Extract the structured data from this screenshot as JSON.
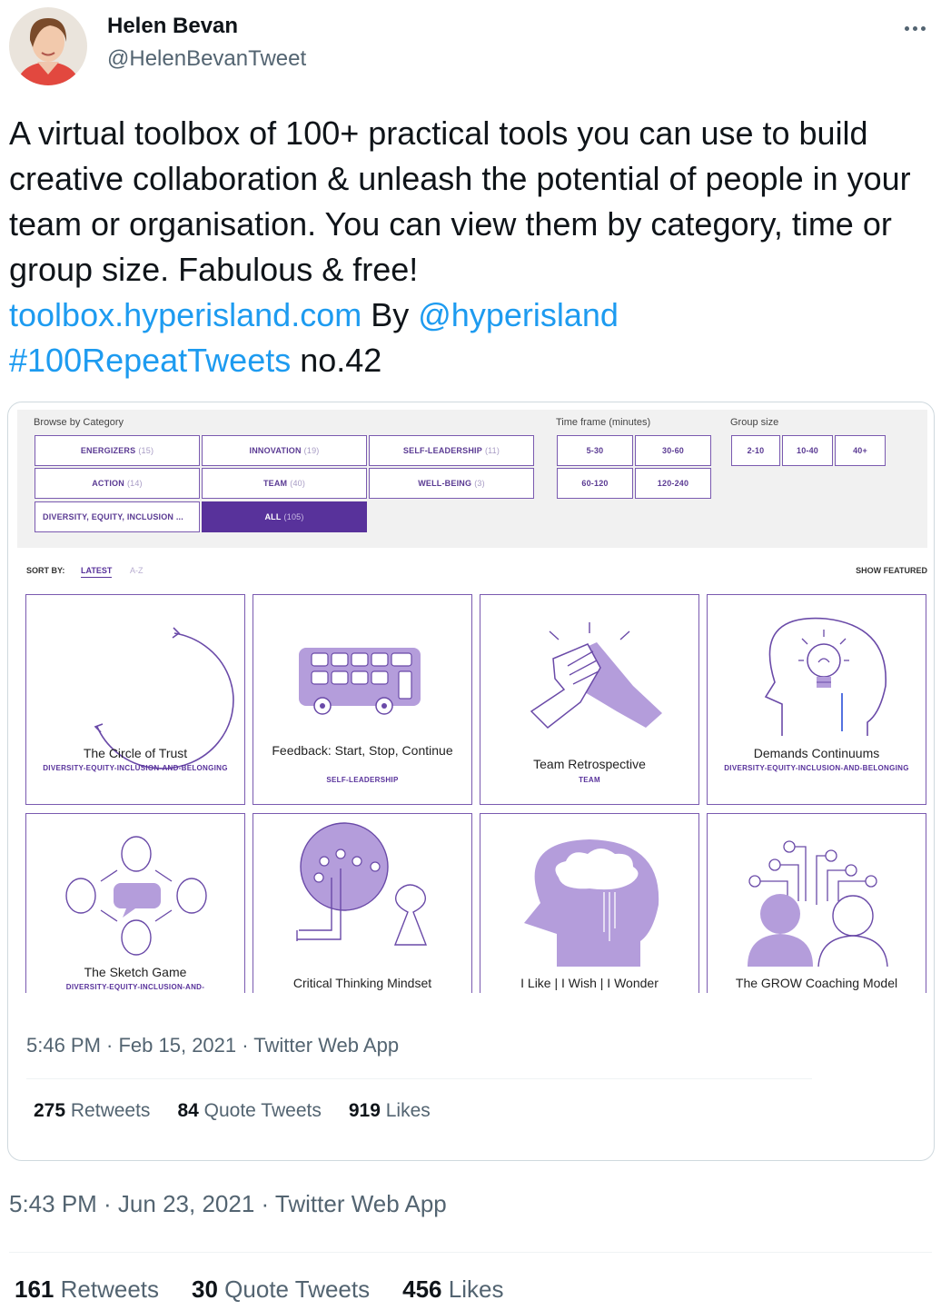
{
  "author": {
    "name": "Helen Bevan",
    "handle": "@HelenBevanTweet"
  },
  "tweet": {
    "text_main": "A virtual toolbox of 100+ practical tools you can use to build creative collaboration & unleash the potential of people in your team or organisation. You can view them by category, time or group size. Fabulous & free!",
    "link_site": "toolbox.hyperisland.com",
    "by_text": "By",
    "mention": "@hyperisland",
    "hashtag": "#100RepeatTweets",
    "suffix": "no.42",
    "timestamp": "5:43 PM · Jun 23, 2021 · Twitter Web App",
    "stats": {
      "retweets_count": "161",
      "retweets_label": "Retweets",
      "quotes_count": "30",
      "quotes_label": "Quote Tweets",
      "likes_count": "456",
      "likes_label": "Likes"
    }
  },
  "quoted": {
    "timestamp": "5:46 PM · Feb 15, 2021 · Twitter Web App",
    "stats": {
      "retweets_count": "275",
      "retweets_label": "Retweets",
      "quotes_count": "84",
      "quotes_label": "Quote Tweets",
      "likes_count": "919",
      "likes_label": "Likes"
    }
  },
  "toolbox": {
    "browse_label": "Browse by Category",
    "timeframe_label": "Time frame (minutes)",
    "groupsize_label": "Group size",
    "categories": [
      {
        "label": "ENERGIZERS",
        "count": "(15)"
      },
      {
        "label": "INNOVATION",
        "count": "(19)"
      },
      {
        "label": "SELF-LEADERSHIP",
        "count": "(11)"
      },
      {
        "label": "ACTION",
        "count": "(14)"
      },
      {
        "label": "TEAM",
        "count": "(40)"
      },
      {
        "label": "WELL-BEING",
        "count": "(3)"
      },
      {
        "label": "DIVERSITY, EQUITY, INCLUSION ...",
        "count": ""
      },
      {
        "label": "ALL",
        "count": "(105)"
      }
    ],
    "timeframes": [
      "5-30",
      "30-60",
      "60-120",
      "120-240"
    ],
    "groupsizes": [
      "2-10",
      "10-40",
      "40+"
    ],
    "sort_label": "SORT BY:",
    "sort_latest": "LATEST",
    "sort_az": "A-Z",
    "show_featured": "SHOW FEATURED",
    "cards": [
      {
        "title": "The Circle of Trust",
        "category": "DIVERSITY-EQUITY-INCLUSION-AND-BELONGING"
      },
      {
        "title": "Feedback: Start, Stop, Continue",
        "category": "SELF-LEADERSHIP"
      },
      {
        "title": "Team Retrospective",
        "category": "TEAM"
      },
      {
        "title": "Demands Continuums",
        "category": "DIVERSITY-EQUITY-INCLUSION-AND-BELONGING"
      },
      {
        "title": "The Sketch Game",
        "category": "DIVERSITY-EQUITY-INCLUSION-AND-"
      },
      {
        "title": "Critical Thinking Mindset",
        "category": ""
      },
      {
        "title": "I Like | I Wish | I Wonder",
        "category": ""
      },
      {
        "title": "The GROW Coaching Model",
        "category": ""
      }
    ]
  },
  "colors": {
    "link": "#1d9bf0",
    "accent_purple": "#58329b",
    "illustration_purple": "#b49ddb"
  }
}
